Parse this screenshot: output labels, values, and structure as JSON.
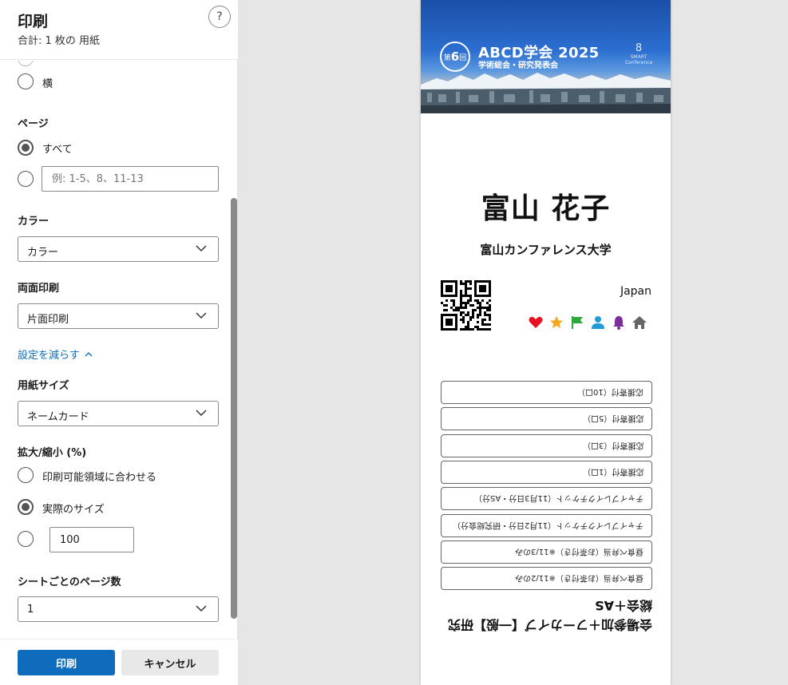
{
  "panel": {
    "title": "印刷",
    "subtitle": "合計: 1 枚の 用紙",
    "help_label": "?",
    "orientation": {
      "landscape_label": "横"
    },
    "pages": {
      "label": "ページ",
      "all_label": "すべて",
      "range_placeholder": "例: 1-5、8、11-13"
    },
    "color": {
      "label": "カラー",
      "value": "カラー"
    },
    "duplex": {
      "label": "両面印刷",
      "value": "片面印刷"
    },
    "fewer_settings": "設定を減らす",
    "paper_size": {
      "label": "用紙サイズ",
      "value": "ネームカード"
    },
    "scale": {
      "label": "拡大/縮小 (%)",
      "fit_label": "印刷可能領域に合わせる",
      "actual_label": "実際のサイズ",
      "custom_value": "100"
    },
    "pages_per_sheet": {
      "label": "シートごとのページ数",
      "value": "1"
    },
    "print_button": "印刷",
    "cancel_button": "キャンセル"
  },
  "preview": {
    "badge_prefix": "第",
    "badge_number": "6",
    "badge_suffix": "回",
    "banner_title": "ABCD学会 2025",
    "banner_subtitle": "学術総会・研究発表会",
    "logo_mark": "8",
    "logo_line1": "SMART",
    "logo_line2": "Conference",
    "name": "富山 花子",
    "affiliation": "富山カンファレンス大学",
    "country": "Japan",
    "icons": [
      "heart-icon",
      "star-icon",
      "flag-icon",
      "person-icon",
      "bell-icon",
      "home-icon"
    ],
    "icon_colors": [
      "#e81123",
      "#f7a51c",
      "#2ea83a",
      "#1f9ad6",
      "#7a2d9b",
      "#666666"
    ],
    "tickets": [
      "応援寄付（10口）",
      "応援寄付（5口）",
      "応援寄付（3口）",
      "応援寄付（1口）",
      "チャイブレイクチケット（11月3日分・AS分）",
      "チャイブレイクチケット（11月2日分・研究総会分）",
      "昼食べ弁当（お茶付き）※11/3のみ",
      "昼食べ弁当（お茶付き）※11/2のみ"
    ],
    "category": "会場参加＋フーカイブ【一般】研究総会＋AS"
  }
}
